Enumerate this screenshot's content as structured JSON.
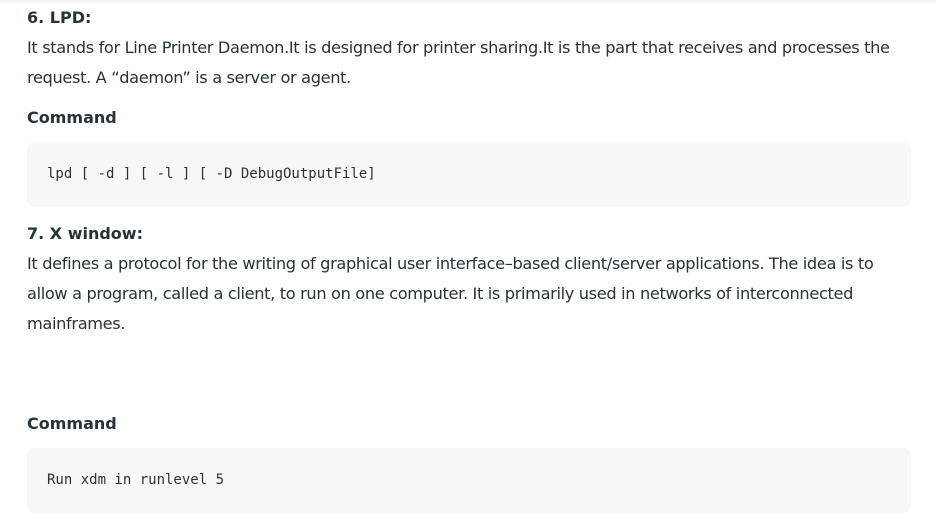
{
  "sections": [
    {
      "heading": "6. LPD:",
      "paragraph": "It stands for Line Printer Daemon.It is designed for printer sharing.It is the part that receives and processes the request. A “daemon” is a server or agent.",
      "command_label": "Command",
      "command": "lpd [ -d ] [ -l ] [ -D DebugOutputFile]"
    },
    {
      "heading": "7. X window:",
      "paragraph": "It defines a protocol for the writing of graphical user interface–based client/server applications. The idea is to allow a program, called a client, to run on one computer. It is primarily used in networks of interconnected mainframes.",
      "command_label": "Command",
      "command": "Run xdm in runlevel 5"
    }
  ]
}
